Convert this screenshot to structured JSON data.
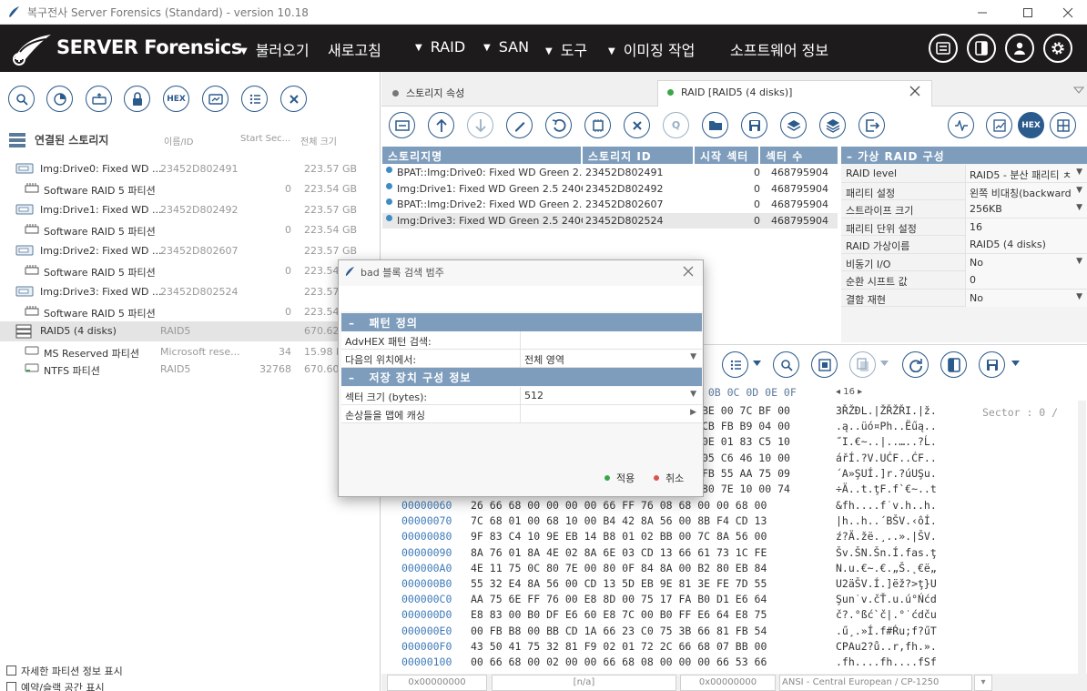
{
  "window": {
    "title": "복구전사 Server Forensics (Standard) - version 10.18"
  },
  "menu": {
    "brand": "SERVER Forensics",
    "items": [
      {
        "label": "불러오기",
        "arrow": true
      },
      {
        "label": "새로고침",
        "arrow": false
      },
      {
        "label": "RAID",
        "arrow": true
      },
      {
        "label": "SAN",
        "arrow": true
      },
      {
        "label": "도구",
        "arrow": true
      },
      {
        "label": "이미징 작업",
        "arrow": true
      },
      {
        "label": "소프트웨어 정보",
        "arrow": false
      }
    ]
  },
  "left": {
    "header": {
      "title": "연결된 스토리지",
      "col_name": "이름/ID",
      "col_start": "Start Sec...",
      "col_size": "전체 크기"
    },
    "rows": [
      {
        "name": "Img:Drive0: Fixed WD ...",
        "id": "23452D802491",
        "start": "",
        "size": "223.57 GB"
      },
      {
        "name": "Software RAID 5 파티션",
        "id": "",
        "start": "0",
        "size": "223.54 GB"
      },
      {
        "name": "Img:Drive1: Fixed WD ...",
        "id": "23452D802492",
        "start": "",
        "size": "223.57 GB"
      },
      {
        "name": "Software RAID 5 파티션",
        "id": "",
        "start": "0",
        "size": "223.54 GB"
      },
      {
        "name": "Img:Drive2: Fixed WD ...",
        "id": "23452D802607",
        "start": "",
        "size": "223.57 GB"
      },
      {
        "name": "Software RAID 5 파티션",
        "id": "",
        "start": "0",
        "size": "223.54"
      },
      {
        "name": "Img:Drive3: Fixed WD ...",
        "id": "23452D802524",
        "start": "",
        "size": "223.57"
      },
      {
        "name": "Software RAID 5 파티션",
        "id": "",
        "start": "0",
        "size": "223.54"
      },
      {
        "name": "RAID5 (4 disks)",
        "id": "RAID5",
        "start": "",
        "size": "670.62"
      },
      {
        "name": "MS Reserved 파티션",
        "id": "Microsoft rese...",
        "start": "34",
        "size": "15.98 M"
      },
      {
        "name": "NTFS 파티션",
        "id": "RAID5",
        "start": "32768",
        "size": "670.60"
      }
    ],
    "footer": [
      "자세한 파티션 정보 표시",
      "예약/슬랙 공간 표시"
    ]
  },
  "tabs": [
    {
      "label": "스토리지 속성"
    },
    {
      "label": "RAID [RAID5 (4 disks)]"
    }
  ],
  "storage_table": {
    "headers": [
      "스토리지명",
      "스토리지 ID",
      "시작 섹터",
      "섹터 수"
    ],
    "rows": [
      [
        "BPAT::Img:Drive0: Fixed WD Green 2.5 ...",
        "23452D802491",
        "0",
        "468795904"
      ],
      [
        "Img:Drive1: Fixed WD Green 2.5 240GB...",
        "23452D802492",
        "0",
        "468795904"
      ],
      [
        "BPAT::Img:Drive2: Fixed WD Green 2.5 ...",
        "23452D802607",
        "0",
        "468795904"
      ],
      [
        "Img:Drive3: Fixed WD Green 2.5 240GB...",
        "23452D802524",
        "0",
        "468795904"
      ]
    ]
  },
  "raid_props": {
    "title": "가상 RAID 구성",
    "rows": [
      {
        "k": "RAID level",
        "v": "RAID5 - 분산 패리티 ㅊ",
        "dd": true
      },
      {
        "k": "패리티 설정",
        "v": "왼쪽 비대칭(backward",
        "dd": true
      },
      {
        "k": "스트라이프 크기",
        "v": "256KB",
        "dd": true
      },
      {
        "k": "패리티 단위 설정",
        "v": "16",
        "dd": false
      },
      {
        "k": "RAID 가상이름",
        "v": "RAID5 (4 disks)",
        "dd": false
      },
      {
        "k": "비동기 I/O",
        "v": "No",
        "dd": true
      },
      {
        "k": "순환 시프트 값",
        "v": "0",
        "dd": false
      },
      {
        "k": "결함 재현",
        "v": "No",
        "dd": true
      }
    ]
  },
  "hex": {
    "header_cols": "A 0B 0C 0D 0E 0F",
    "page_control": "16",
    "sector_label": "Sector : 0 /",
    "visible_top": [
      {
        "bytes": "BE 00 7C BF 00",
        "text": "3ŘŽĐL.|ŽŘŽŘI.|ž."
      },
      {
        "bytes": "CB FB B9 04 00",
        "text": ".ą..üó¤Ph..Ëűą.."
      },
      {
        "bytes": "0E 01 83 C5 10",
        "text": "˝I.€~..|..…..?Ĺ."
      },
      {
        "bytes": "05 C6 46 10 00",
        "text": "ářÍ.?V.UĆF..ĆF.."
      },
      {
        "bytes": "FB 55 AA 75 09",
        "text": "´A»ŞUÍ.]r.?úUŞu."
      },
      {
        "bytes": "80 7E 10 00 74",
        "text": "÷Ä..t.ţF.f`€~..t"
      }
    ],
    "rows": [
      {
        "off": "00000060",
        "bytes": "26 66 68 00 00 00 00 66 FF 76 08 68 00 00 68 00",
        "text": "&fh....f˙v.h..h."
      },
      {
        "off": "00000070",
        "bytes": "7C 68 01 00 68 10 00 B4 42 8A 56 00 8B F4 CD 13",
        "text": "|h..h..´BŠV.‹ôÍ."
      },
      {
        "off": "00000080",
        "bytes": "9F 83 C4 10 9E EB 14 B8 01 02 BB 00 7C 8A 56 00",
        "text": "ź?Ä.žë.¸..».|ŠV."
      },
      {
        "off": "00000090",
        "bytes": "8A 76 01 8A 4E 02 8A 6E 03 CD 13 66 61 73 1C FE",
        "text": "Šv.ŠN.Šn.Í.fas.ţ"
      },
      {
        "off": "000000A0",
        "bytes": "4E 11 75 0C 80 7E 00 80 0F 84 8A 00 B2 80 EB 84",
        "text": "N.u.€~.€.„Š.˛€ë„"
      },
      {
        "off": "000000B0",
        "bytes": "55 32 E4 8A 56 00 CD 13 5D EB 9E 81 3E FE 7D 55",
        "text": "U2äŠV.Í.]ëž?>ţ}U"
      },
      {
        "off": "000000C0",
        "bytes": "AA 75 6E FF 76 00 E8 8D 00 75 17 FA B0 D1 E6 64",
        "text": "Şun˙v.čŤ.u.ú°Ńćd"
      },
      {
        "off": "000000D0",
        "bytes": "E8 83 00 B0 DF E6 60 E8 7C 00 B0 FF E6 64 E8 75",
        "text": "č?.°ßć`č|.°˙ćdču"
      },
      {
        "off": "000000E0",
        "bytes": "00 FB B8 00 BB CD 1A 66 23 C0 75 3B 66 81 FB 54",
        "text": ".ű¸.»Í.f#Ŕu;f?űT"
      },
      {
        "off": "000000F0",
        "bytes": "43 50 41 75 32 81 F9 02 01 72 2C 66 68 07 BB 00",
        "text": "CPAu2?ů..r,fh.»."
      },
      {
        "off": "00000100",
        "bytes": "00 66 68 00 02 00 00 66 68 08 00 00 00 66 53 66",
        "text": ".fh....fh....fSf"
      }
    ]
  },
  "status": [
    "0x00000000",
    "[n/a]",
    "0x00000000",
    "ANSI - Central European / CP-1250"
  ],
  "dialog": {
    "title": "bad 블록 검색 범주",
    "section1": "패턴 정의",
    "s1_rows": [
      {
        "k": "AdvHEX 패턴 검색:",
        "v": "",
        "dd": false
      },
      {
        "k": "다음의 위치에서:",
        "v": "전체 영역",
        "dd": true
      }
    ],
    "section2": "저장 장치 구성 정보",
    "s2_rows": [
      {
        "k": "섹터 크기 (bytes):",
        "v": "512",
        "dd": true
      },
      {
        "k": "손상들을 맵에 캐싱",
        "v": "",
        "dd": false
      }
    ],
    "apply": "적용",
    "cancel": "취소",
    "colors": {
      "apply": "#3aa64a",
      "cancel": "#d9534f"
    }
  },
  "colors": {
    "menubar": "#1d1b1b",
    "accent": "#2b5a8c",
    "header": "#7e9dbc"
  }
}
